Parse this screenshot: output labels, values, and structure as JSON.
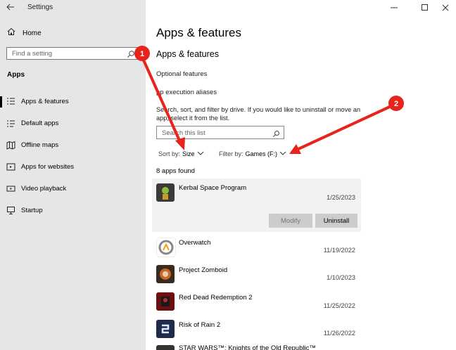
{
  "window": {
    "title": "Settings",
    "accent": "#000000"
  },
  "sidebar": {
    "home_label": "Home",
    "search_placeholder": "Find a setting",
    "section_title": "Apps",
    "items": [
      {
        "label": "Apps & features",
        "icon": "list-icon",
        "active": true
      },
      {
        "label": "Default apps",
        "icon": "default-apps-icon",
        "active": false
      },
      {
        "label": "Offline maps",
        "icon": "map-icon",
        "active": false
      },
      {
        "label": "Apps for websites",
        "icon": "website-icon",
        "active": false
      },
      {
        "label": "Video playback",
        "icon": "video-icon",
        "active": false
      },
      {
        "label": "Startup",
        "icon": "startup-icon",
        "active": false
      }
    ]
  },
  "main": {
    "title": "Apps & features",
    "subtitle": "Apps & features",
    "links": [
      "Optional features",
      "pp execution aliases"
    ],
    "description": "Search, sort, and filter by drive. If you would like to uninstall or move an app, select it from the list.",
    "list_search_placeholder": "Search this list",
    "sort_key": "Sort by:",
    "sort_value": "Size",
    "filter_key": "Filter by:",
    "filter_value": "Games (F:)",
    "count_text": "8 apps found",
    "apps": [
      {
        "name": "Kerbal Space Program",
        "date": "1/25/2023",
        "expanded": true
      },
      {
        "name": "Overwatch",
        "date": "11/19/2022",
        "expanded": false
      },
      {
        "name": "Project Zomboid",
        "date": "1/10/2023",
        "expanded": false
      },
      {
        "name": "Red Dead Redemption 2",
        "date": "11/25/2022",
        "expanded": false
      },
      {
        "name": "Risk of Rain 2",
        "date": "11/26/2022",
        "expanded": false
      },
      {
        "name": "STAR WARS™: Knights of the Old Republic™",
        "date": "",
        "expanded": false
      }
    ],
    "modify_label": "Modify",
    "uninstall_label": "Uninstall"
  },
  "annotations": {
    "marker_color": "#e8231c",
    "badges": [
      "1",
      "2"
    ]
  }
}
